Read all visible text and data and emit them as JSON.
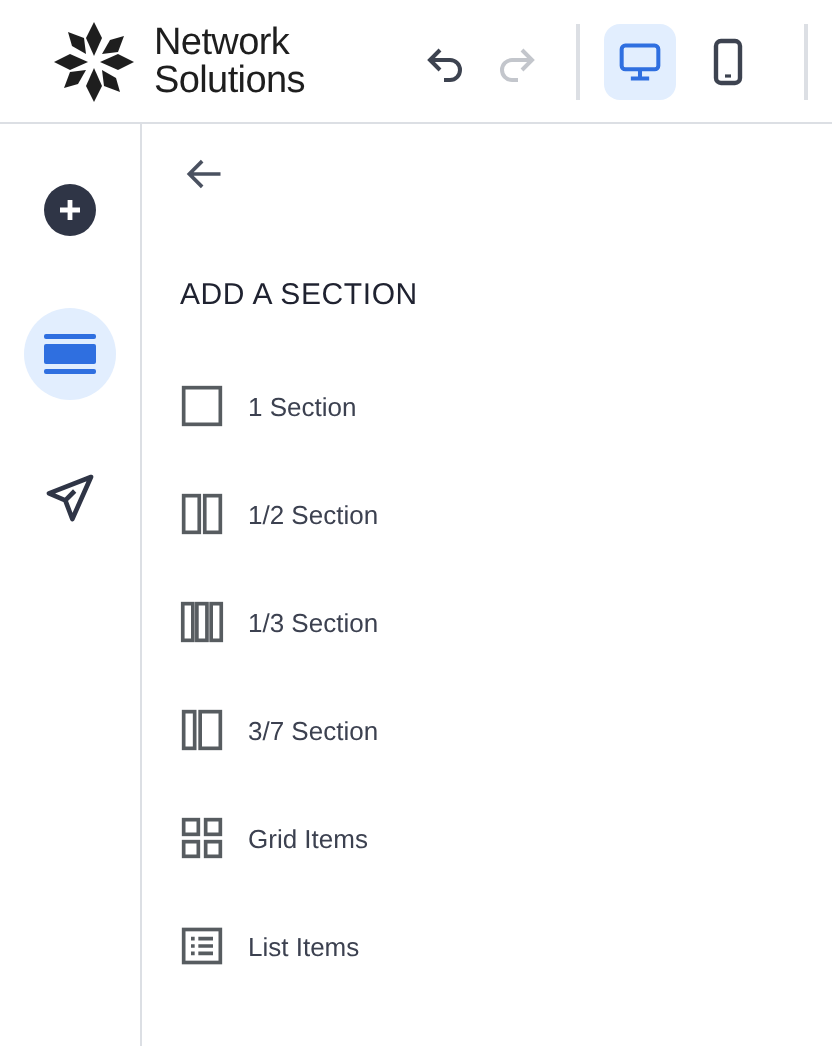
{
  "header": {
    "logo_lines": [
      "Network",
      "Solutions"
    ],
    "undo": {
      "disabled": false
    },
    "redo": {
      "disabled": true
    },
    "devices": [
      {
        "kind": "desktop",
        "selected": true
      },
      {
        "kind": "mobile",
        "selected": false
      }
    ]
  },
  "rail": [
    {
      "kind": "add",
      "selected": false
    },
    {
      "kind": "sections",
      "selected": true
    },
    {
      "kind": "publish",
      "selected": false
    }
  ],
  "panel": {
    "title": "ADD A SECTION",
    "items": [
      {
        "kind": "one",
        "label": "1 Section"
      },
      {
        "kind": "half",
        "label": "1/2 Section"
      },
      {
        "kind": "third",
        "label": "1/3 Section"
      },
      {
        "kind": "three-seven",
        "label": "3/7 Section"
      },
      {
        "kind": "grid",
        "label": "Grid Items"
      },
      {
        "kind": "list",
        "label": "List Items"
      }
    ]
  }
}
